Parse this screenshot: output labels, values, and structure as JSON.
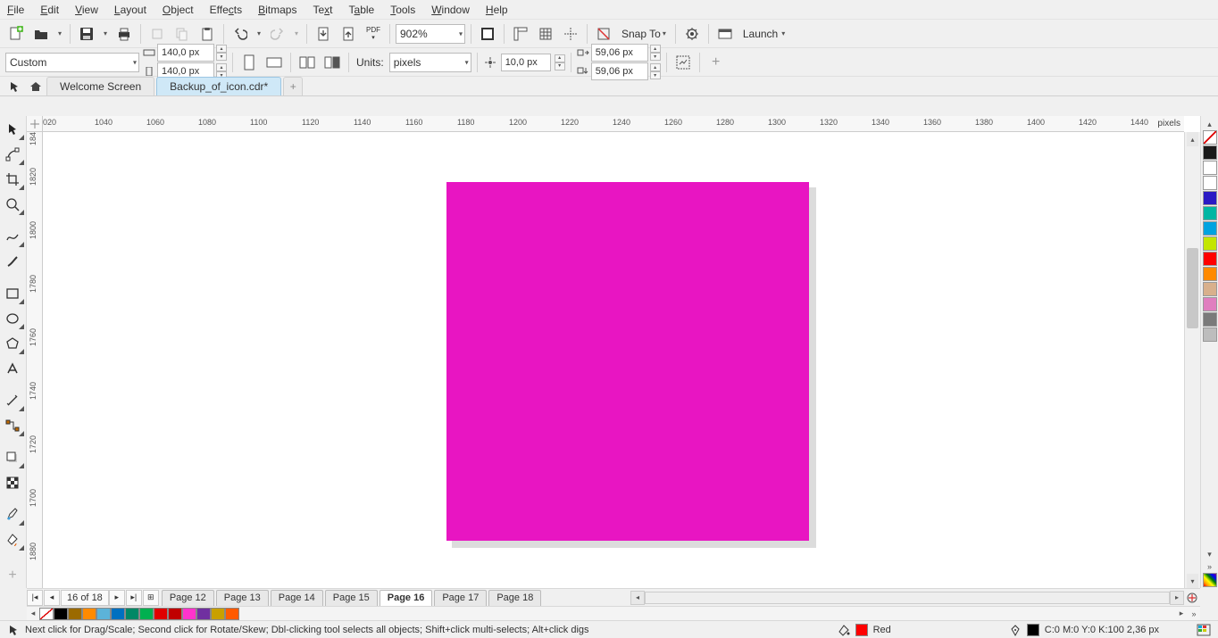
{
  "menu": {
    "items": [
      "File",
      "Edit",
      "View",
      "Layout",
      "Object",
      "Effects",
      "Bitmaps",
      "Text",
      "Table",
      "Tools",
      "Window",
      "Help"
    ]
  },
  "toolbar1": {
    "zoom_value": "902%",
    "snap_label": "Snap To",
    "launch_label": "Launch"
  },
  "toolbar2": {
    "page_preset": "Custom",
    "width": "140,0 px",
    "height": "140,0 px",
    "units_label": "Units:",
    "units_value": "pixels",
    "nudge": "10,0 px",
    "dup_x": "59,06 px",
    "dup_y": "59,06 px"
  },
  "doctabs": {
    "home_icon": "home-icon",
    "welcome": "Welcome Screen",
    "active_doc": "Backup_of_icon.cdr*"
  },
  "ruler": {
    "h_labels": [
      "020",
      "1040",
      "1060",
      "1080",
      "1100",
      "1120",
      "1140",
      "1160",
      "1180",
      "1200",
      "1220",
      "1240",
      "1260",
      "1280",
      "1300",
      "1320",
      "1340",
      "1360",
      "1380",
      "1400",
      "1420",
      "1440"
    ],
    "h_unit": "pixels",
    "v_labels": [
      "184",
      "1820",
      "1800",
      "1780",
      "1760",
      "1740",
      "1720",
      "1700",
      "1880"
    ]
  },
  "pagebar": {
    "current": "16",
    "of_label": "of",
    "total": "18",
    "tabs": [
      "Page 12",
      "Page 13",
      "Page 14",
      "Page 15",
      "Page 16",
      "Page 17",
      "Page 18"
    ],
    "active_index": 4
  },
  "status": {
    "hint": "Next click for Drag/Scale; Second click for Rotate/Skew; Dbl-clicking tool selects all objects; Shift+click multi-selects; Alt+click digs",
    "fill_name": "Red",
    "fill_color": "#ff0000",
    "outline_info": "C:0 M:0 Y:0 K:100  2,36 px",
    "outline_color": "#000000"
  },
  "palette_right": [
    {
      "c": "none"
    },
    {
      "c": "#1a1a1a"
    },
    {
      "c": "#ffffff"
    },
    {
      "c": "#ffffff"
    },
    {
      "c": "#2a1ac4"
    },
    {
      "c": "#00b6a3"
    },
    {
      "c": "#00a3e0"
    },
    {
      "c": "#c3e600"
    },
    {
      "c": "#ff0000"
    },
    {
      "c": "#ff8a00"
    },
    {
      "c": "#d8b08c"
    },
    {
      "c": "#e07ebf"
    },
    {
      "c": "#7a7a7a"
    },
    {
      "c": "#bdbdbd"
    }
  ],
  "palette_bottom": [
    {
      "c": "none"
    },
    {
      "c": "#000000"
    },
    {
      "c": "#9b6a00"
    },
    {
      "c": "#ff8a00"
    },
    {
      "c": "#5cb3d9"
    },
    {
      "c": "#0070c0"
    },
    {
      "c": "#008866"
    },
    {
      "c": "#00b050"
    },
    {
      "c": "#e00000"
    },
    {
      "c": "#c00000"
    },
    {
      "c": "#ff33cc"
    },
    {
      "c": "#7030a0"
    },
    {
      "c": "#c8a000"
    },
    {
      "c": "#ff5a00"
    }
  ],
  "canvas": {
    "shape_color": "#e815c2"
  }
}
